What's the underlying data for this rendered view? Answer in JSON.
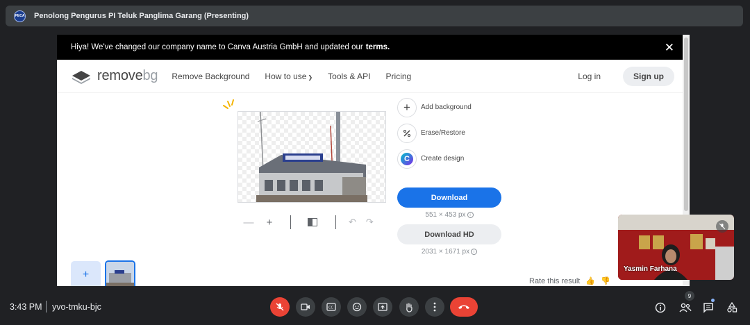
{
  "meet": {
    "presenter_title": "Penolong Pengurus PI Teluk Panglima Garang (Presenting)",
    "clock": "3:43 PM",
    "meeting_code": "yvo-tmku-bjc",
    "participant_count": "9",
    "self_view": {
      "name": "Yasmin Farhana"
    },
    "colors": {
      "background": "#202124",
      "surface": "#3c4043",
      "end_call": "#ea4335",
      "accent": "#8ab4f8"
    }
  },
  "site": {
    "notice": {
      "text": "Hiya! We've changed our company name to Canva Austria GmbH and updated our",
      "link": "terms."
    },
    "logo": {
      "part1": "remove",
      "part2": "bg"
    },
    "nav": {
      "remove_background": "Remove Background",
      "how_to_use": "How to use",
      "tools_api": "Tools & API",
      "pricing": "Pricing"
    },
    "login": "Log in",
    "signup": "Sign up",
    "tools": {
      "add_background": "Add background",
      "erase_restore": "Erase/Restore",
      "create_design": "Create design"
    },
    "download": {
      "label": "Download",
      "size": "551 × 453 px"
    },
    "download_hd": {
      "label": "Download HD",
      "size": "2031 × 1671 px"
    },
    "add_button": "+",
    "rate": "Rate this result",
    "colors": {
      "primary": "#1a73e8",
      "text": "#454545",
      "muted": "#8a8f95"
    }
  }
}
